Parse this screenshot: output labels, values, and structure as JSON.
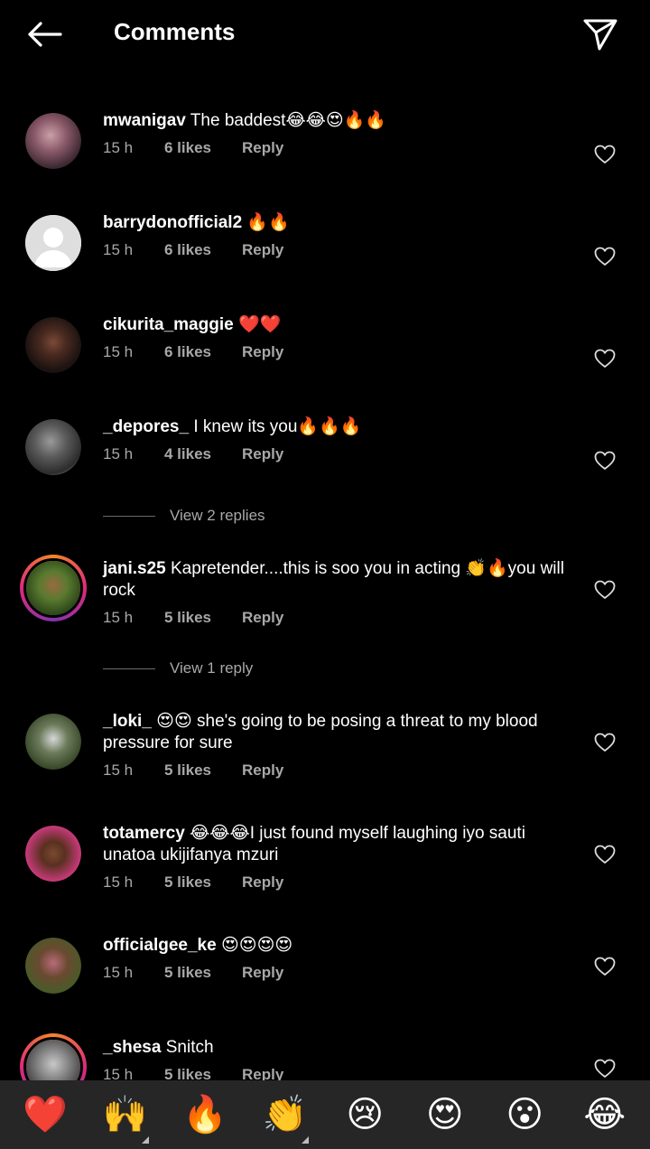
{
  "header": {
    "title": "Comments"
  },
  "comments": [
    {
      "user": "mwanigav",
      "text": " The baddest😂😂😍🔥🔥",
      "time": "15 h",
      "likes": "6 likes",
      "reply": "Reply"
    },
    {
      "user": "barrydonofficial2",
      "text": " 🔥🔥",
      "time": "15 h",
      "likes": "6 likes",
      "reply": "Reply"
    },
    {
      "user": "cikurita_maggie",
      "text": " ❤️❤️",
      "time": "15 h",
      "likes": "6 likes",
      "reply": "Reply"
    },
    {
      "user": "_depores_",
      "text": " I knew its you🔥🔥🔥",
      "time": "15 h",
      "likes": "4 likes",
      "reply": "Reply"
    },
    {
      "user": "jani.s25",
      "text": " Kapretender....this is soo you  in acting 👏🔥you will rock",
      "time": "15 h",
      "likes": "5 likes",
      "reply": "Reply"
    },
    {
      "user": "_loki_",
      "text": " 😍😍 she's going to be posing a threat to my blood pressure for sure",
      "time": "15 h",
      "likes": "5 likes",
      "reply": "Reply"
    },
    {
      "user": "totamercy",
      "text": " 😂😂😂I just found myself laughing iyo sauti unatoa ukijifanya mzuri",
      "time": "15 h",
      "likes": "5 likes",
      "reply": "Reply"
    },
    {
      "user": "officialgee_ke",
      "text": " 😍😍😍😍",
      "time": "15 h",
      "likes": "5 likes",
      "reply": "Reply"
    },
    {
      "user": "_shesa",
      "text": " Snitch",
      "time": "15 h",
      "likes": "5 likes",
      "reply": "Reply"
    }
  ],
  "view_replies": [
    "View 2 replies",
    "View 1 reply"
  ],
  "emoji_bar": [
    "❤️",
    "🙌",
    "🔥",
    "👏",
    "😢",
    "😍",
    "😮",
    "😂"
  ],
  "colors": {
    "background": "#000000",
    "secondary_text": "#a8a8a8",
    "emoji_bar_bg": "#262626"
  },
  "icons": {
    "back": "arrow-left-icon",
    "share": "paper-plane-icon",
    "like": "heart-outline-icon"
  }
}
